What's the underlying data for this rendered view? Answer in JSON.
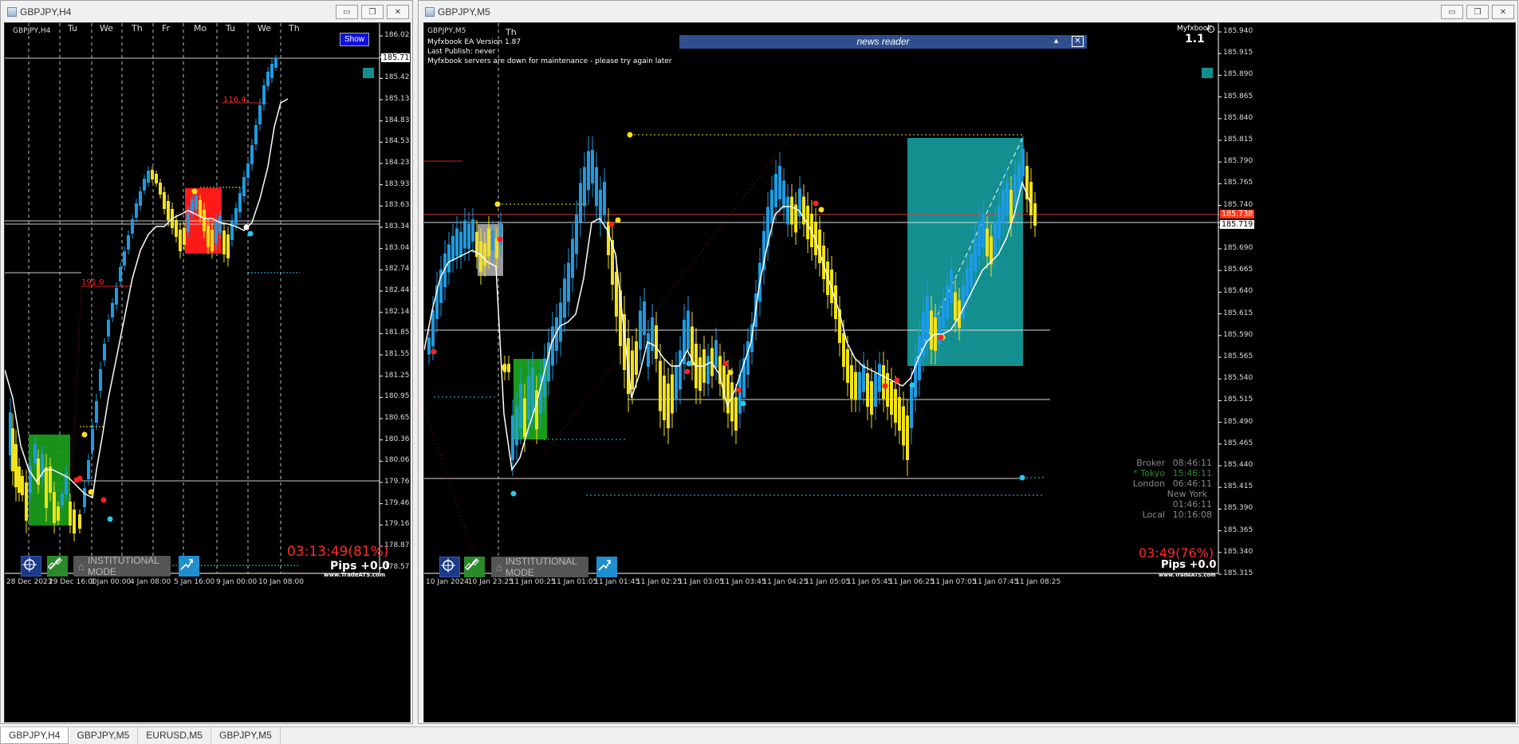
{
  "left_window": {
    "title": "GBPJPY,H4",
    "symbol_label": "GBPJPY,H4",
    "day_labels": [
      "Tu",
      "We",
      "Th",
      "Fr",
      "Mo",
      "Tu",
      "We",
      "Th"
    ],
    "show_button": "Show",
    "price_labels": [
      "186.020",
      "185.719",
      "185.425",
      "185.130",
      "184.830",
      "184.530",
      "184.235",
      "183.935",
      "183.635",
      "183.340",
      "183.040",
      "182.745",
      "182.445",
      "182.145",
      "181.850",
      "181.550",
      "181.255",
      "180.955",
      "180.655",
      "180.360",
      "180.060",
      "179.765",
      "179.465",
      "179.165",
      "178.870",
      "178.570"
    ],
    "current_price": "185.719",
    "time_labels": [
      "28 Dec 2023",
      "29 Dec 16:00",
      "3 Jan 00:00",
      "4 Jan 08:00",
      "5 Jan 16:00",
      "9 Jan 00:00",
      "10 Jan 08:00"
    ],
    "annotation_1": "116.4",
    "annotation_2": "191.0",
    "countdown": "03:13:49(81%)",
    "pips": "Pips +0.0",
    "brand": "www.TradeATS.com",
    "inst_mode": "INSTITUTIONAL MODE"
  },
  "right_window": {
    "title": "GBPJPY,M5",
    "symbol_label": "GBPJPY,M5",
    "day_label": "Th",
    "ea_version": "Myfxbook EA Version 1.87",
    "last_publish": "Last Publish: never",
    "maintenance": "Myfxbook servers are down for maintenance - please try again later",
    "news_reader": "news reader",
    "myfxbook_corner": "Myfxbook",
    "version_big": "1.1",
    "price_labels": [
      "185.940",
      "185.915",
      "185.890",
      "185.865",
      "185.840",
      "185.815",
      "185.790",
      "185.765",
      "185.740",
      "185.715",
      "185.690",
      "185.665",
      "185.640",
      "185.615",
      "185.590",
      "185.565",
      "185.540",
      "185.515",
      "185.490",
      "185.465",
      "185.440",
      "185.415",
      "185.390",
      "185.365",
      "185.340",
      "185.315"
    ],
    "current_price_red": "185.738",
    "current_price": "185.719",
    "time_labels": [
      "10 Jan 2024",
      "10 Jan 23:25",
      "11 Jan 00:25",
      "11 Jan 01:05",
      "11 Jan 01:45",
      "11 Jan 02:25",
      "11 Jan 03:05",
      "11 Jan 03:45",
      "11 Jan 04:25",
      "11 Jan 05:05",
      "11 Jan 05:45",
      "11 Jan 06:25",
      "11 Jan 07:05",
      "11 Jan 07:45",
      "11 Jan 08:25"
    ],
    "sessions": [
      {
        "name": "Broker",
        "time": "08:46:11",
        "color": "#8a8a8a"
      },
      {
        "name": "* Tokyo",
        "time": "15:46:11",
        "color": "#2e8b2e"
      },
      {
        "name": "London",
        "time": "06:46:11",
        "color": "#8a8a8a"
      },
      {
        "name": "New York",
        "time": "01:46:11",
        "color": "#8a8a8a"
      },
      {
        "name": "Local",
        "time": "10:16:08",
        "color": "#8a8a8a"
      }
    ],
    "countdown": "03:49(76%)",
    "pips": "Pips +0.0",
    "brand": "www.TradeATS.com",
    "inst_mode": "INSTITUTIONAL MODE"
  },
  "tabs": [
    "GBPJPY,H4",
    "GBPJPY,M5",
    "EURUSD,M5",
    "GBPJPY,M5"
  ],
  "window_buttons": {
    "minimize": "▭",
    "restore": "❐",
    "close": "✕"
  },
  "colors": {
    "bull": "#1e9be0",
    "bear": "#f2e21a",
    "red_zone": "#ff1a1a",
    "green_zone": "#1a9a1a",
    "teal_zone": "#138f8f",
    "countdown": "#ff2a2a"
  }
}
